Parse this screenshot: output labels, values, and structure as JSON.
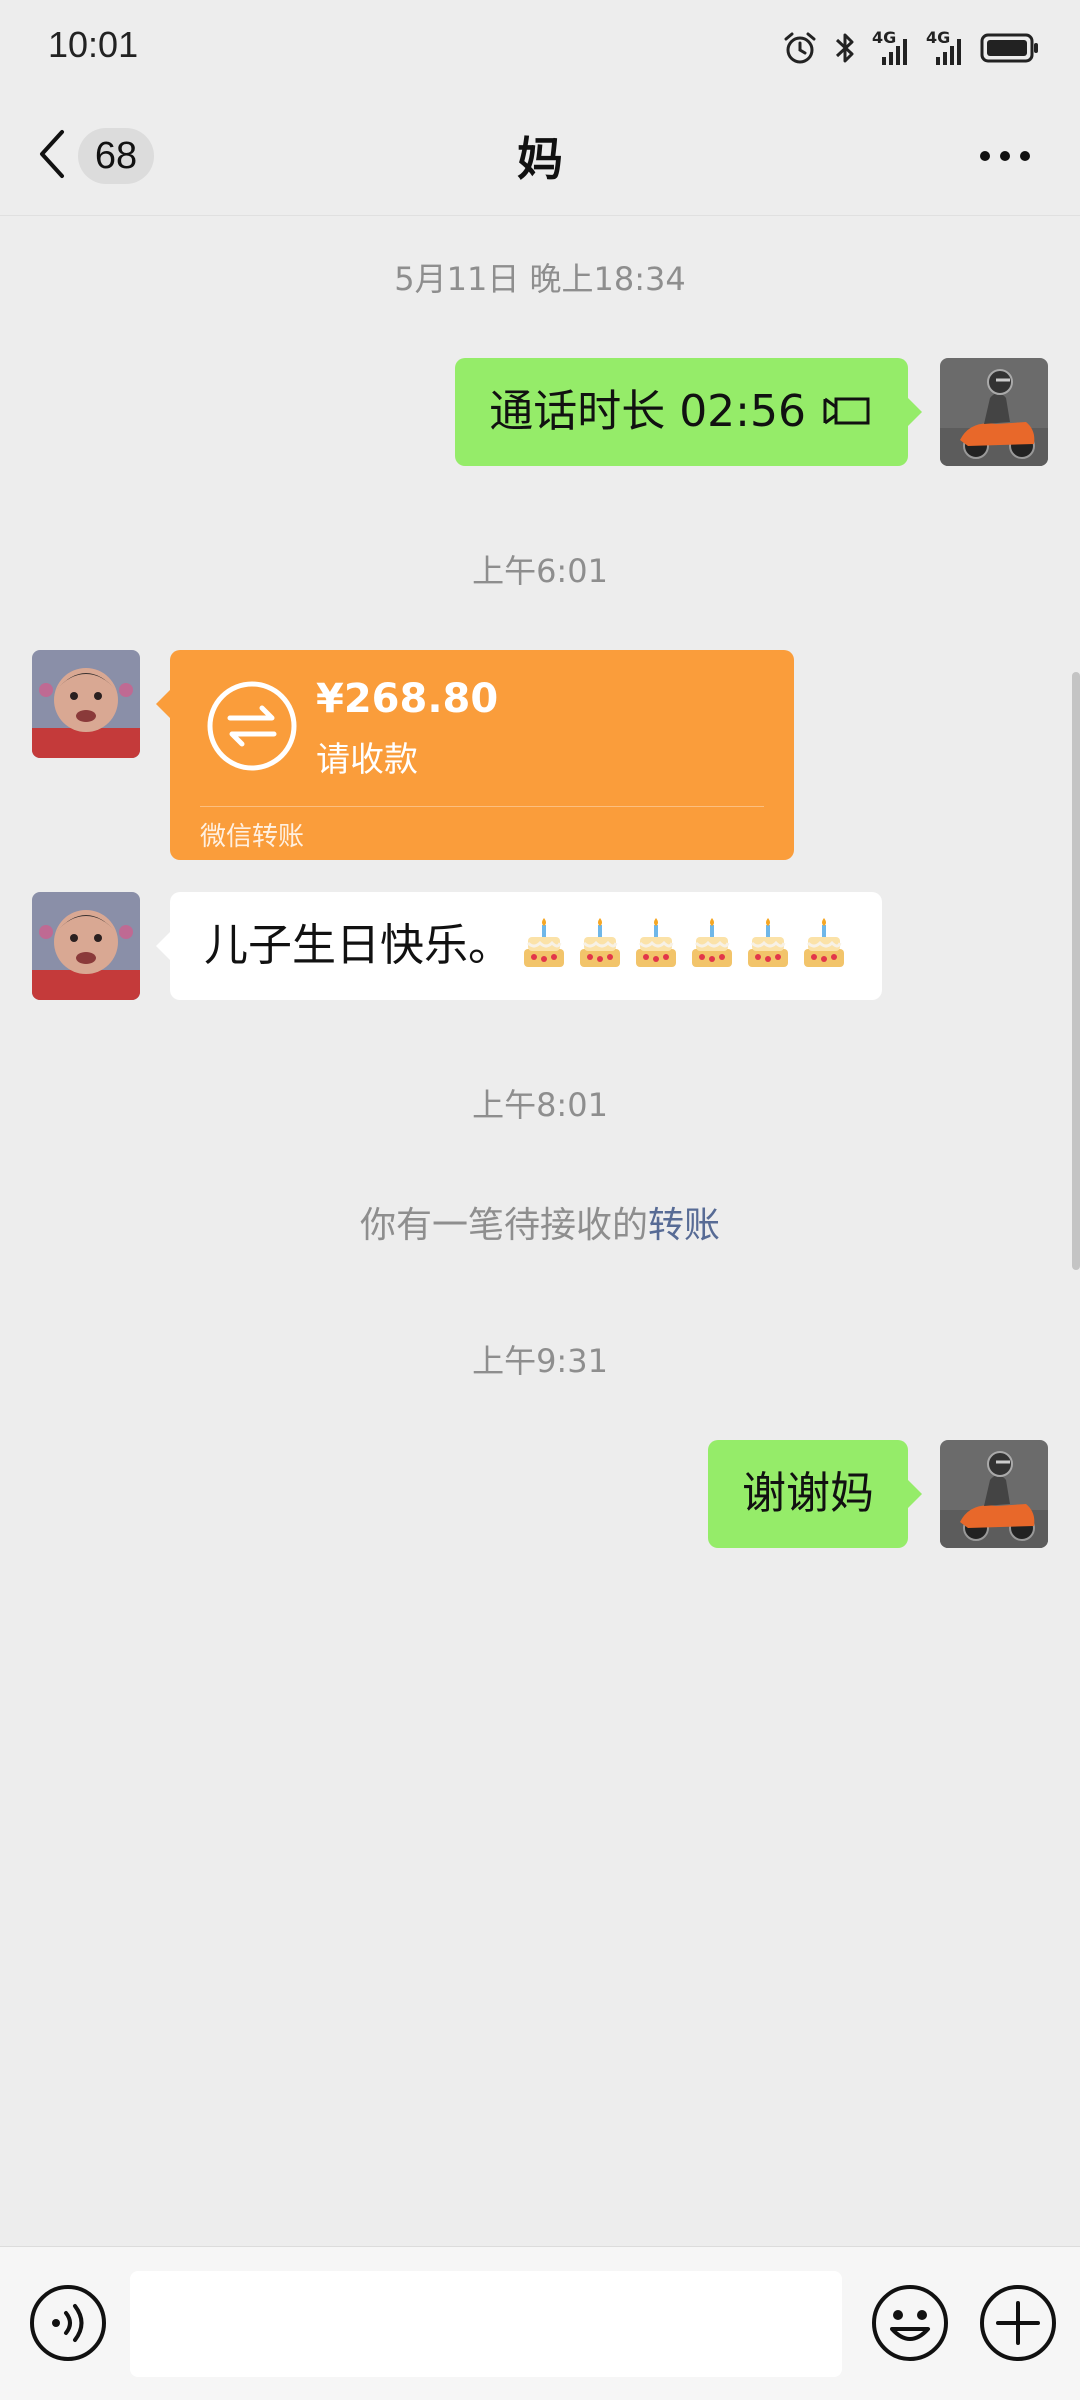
{
  "status_bar": {
    "time": "10:01",
    "network_1": "4G",
    "network_2": "4G",
    "icons": [
      "alarm-icon",
      "bluetooth-icon",
      "signal-4g-icon",
      "signal-4g-icon",
      "battery-icon"
    ]
  },
  "header": {
    "unread_count": "68",
    "title": "妈",
    "back_icon": "chevron-left-icon",
    "more_icon": "more-dots-icon"
  },
  "messages": {
    "ts_1": "5月11日 晚上18:34",
    "call": {
      "text": "通话时长 02:56",
      "icon": "video-call-icon"
    },
    "ts_2": "上午6:01",
    "transfer": {
      "amount": "¥268.80",
      "note": "请收款",
      "footer": "微信转账",
      "icon": "transfer-arrows-icon"
    },
    "greeting": {
      "text": "儿子生日快乐。",
      "emoji": "birthday-cake-icon",
      "emoji_count": 6
    },
    "ts_3": "上午8:01",
    "system": {
      "prefix": "你有一笔待接收的",
      "link": "转账"
    },
    "ts_4": "上午9:31",
    "reply": {
      "text": "谢谢妈"
    }
  },
  "input_bar": {
    "placeholder": "",
    "voice_icon": "voice-input-icon",
    "emoji_icon": "emoji-icon",
    "plus_icon": "plus-icon"
  },
  "colors": {
    "background": "#ededed",
    "sent_bubble": "#95ec69",
    "received_bubble": "#ffffff",
    "transfer_card": "#fa9d3b",
    "link": "#576b95"
  }
}
